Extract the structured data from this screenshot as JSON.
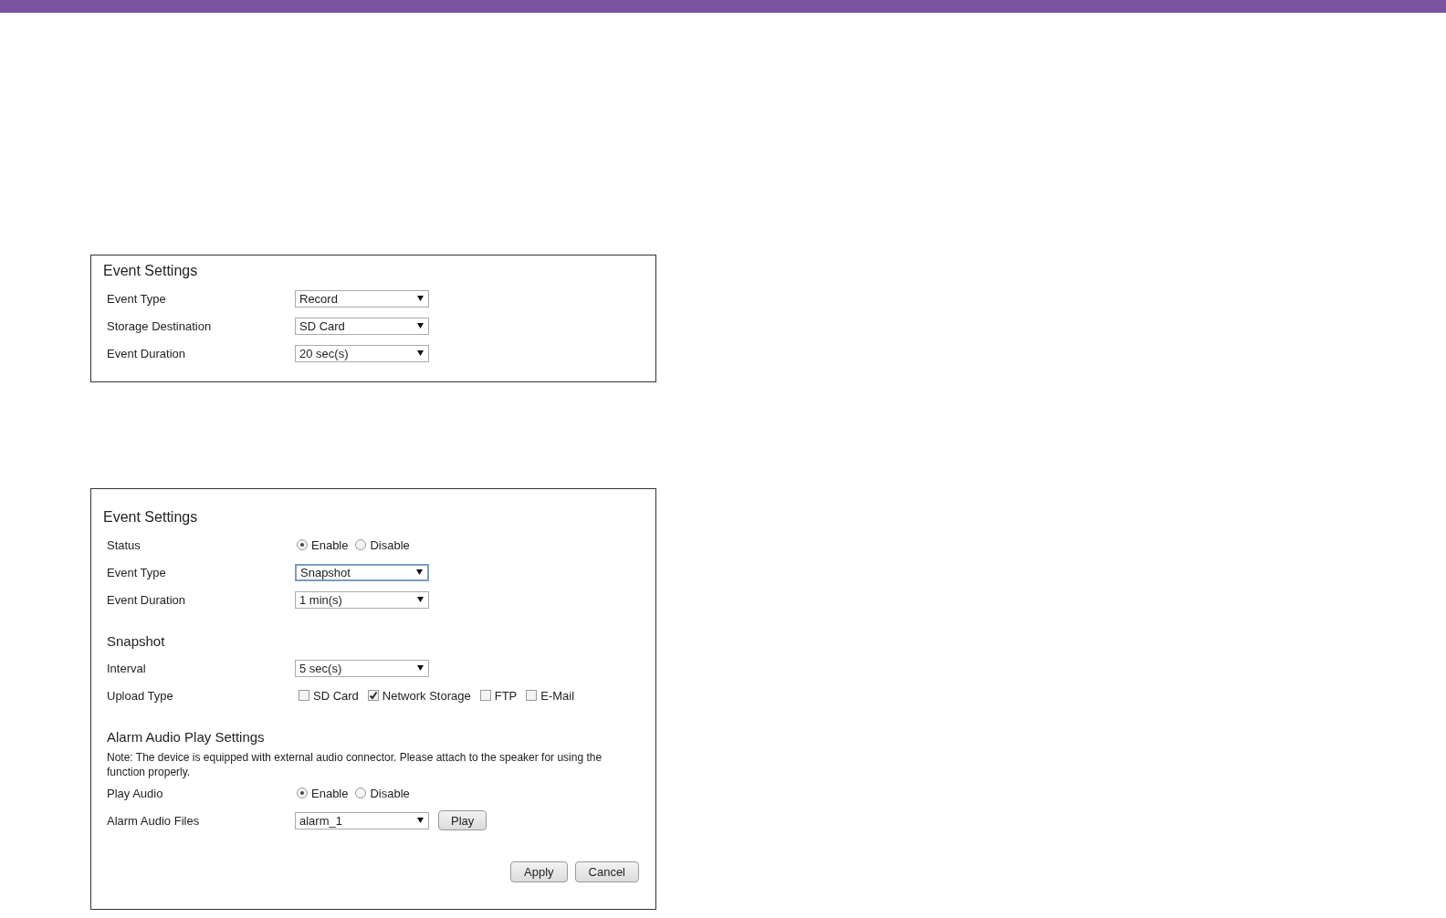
{
  "panels": [
    {
      "title": "Event Settings",
      "rows": [
        {
          "kind": "select",
          "label": "Event Type",
          "value": "Record",
          "focused": false
        },
        {
          "kind": "select",
          "label": "Storage Destination",
          "value": "SD Card",
          "focused": false
        },
        {
          "kind": "select",
          "label": "Event Duration",
          "value": "20 sec(s)",
          "focused": false
        }
      ]
    },
    {
      "title": "Event Settings",
      "rows": [
        {
          "kind": "radio",
          "label": "Status",
          "options": [
            {
              "label": "Enable",
              "selected": true
            },
            {
              "label": "Disable",
              "selected": false
            }
          ]
        },
        {
          "kind": "select",
          "label": "Event Type",
          "value": "Snapshot",
          "focused": true
        },
        {
          "kind": "select",
          "label": "Event Duration",
          "value": "1 min(s)",
          "focused": false
        }
      ],
      "sections": [
        {
          "heading": "Snapshot",
          "rows": [
            {
              "kind": "select",
              "label": "Interval",
              "value": "5 sec(s)",
              "focused": false
            },
            {
              "kind": "checkbox",
              "label": "Upload Type",
              "options": [
                {
                  "label": "SD Card",
                  "checked": false
                },
                {
                  "label": "Network Storage",
                  "checked": true
                },
                {
                  "label": "FTP",
                  "checked": false
                },
                {
                  "label": "E-Mail",
                  "checked": false
                }
              ]
            }
          ]
        },
        {
          "heading": "Alarm Audio Play Settings",
          "note": "Note: The device is equipped with external audio connector. Please attach to the speaker for using the function properly.",
          "rows": [
            {
              "kind": "radio",
              "label": "Play Audio",
              "options": [
                {
                  "label": "Enable",
                  "selected": true
                },
                {
                  "label": "Disable",
                  "selected": false
                }
              ]
            },
            {
              "kind": "select_button",
              "label": "Alarm Audio Files",
              "value": "alarm_1",
              "focused": false,
              "button": "Play"
            }
          ]
        }
      ],
      "buttons": [
        "Apply",
        "Cancel"
      ]
    }
  ]
}
